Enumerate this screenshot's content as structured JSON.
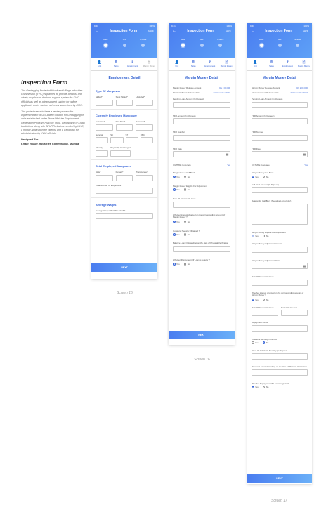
{
  "intro": {
    "title": "Inspection Form",
    "para1": "The Geotagging Project of Khadi and Village Industries Commission (KVIC) is planned to provide a robust and widely map based decision support system for KVIC officials as well as a transparent system for online applicants under various schemes supervised by KVIC.",
    "para2": "The project seeks to have a tender process for implementation of GIS-based solution for Geotagging of units established under Prime Minister Employment Generation Program PMEGP, India, Geotagging of Khadi institutions along with SFURTI clusters needed by KVIC, a mobile application for citizens and a Geoportal for administration by KVIC officials.",
    "designed_for": "Designed For -",
    "client": "Khadi Village Industries Commission, Mumbai"
  },
  "app": {
    "status_time": "9:41",
    "status_right": "100%",
    "back": "←",
    "title": "Inspection Form",
    "save": "SAVE",
    "steps": [
      "Basic",
      "Unit",
      "Scheme"
    ],
    "tabs": [
      {
        "label": "Unit",
        "icon": "👤"
      },
      {
        "label": "Sales",
        "icon": "🖩"
      },
      {
        "label": "Employment",
        "icon": "₹"
      },
      {
        "label": "Margin Money",
        "icon": "🗎"
      }
    ],
    "next": "NEXT"
  },
  "screen15": {
    "section": "Employment Detail",
    "type_of_manpower": "Type Of Manpower",
    "skilled": "Skilled*",
    "semi_skilled": "Semi Skilled*",
    "unskilled": "Unskilled*",
    "current_manpower": "Currently Employed Manpower",
    "full_time": "Full Time*",
    "part_time": "Part Time*",
    "seasonal": "Seasonal*",
    "general": "General",
    "sc": "SC",
    "st": "ST",
    "obc": "OBC",
    "minority": "Minority",
    "physically_challenged": "Physically Challenged",
    "total_manpower": "Total Employed Manpower",
    "male": "Male*",
    "female": "Female*",
    "transgender": "Transgender*",
    "total_employees": "Total Number Of Employees",
    "average_wages": "Average Wages",
    "avg_wages_paid": "Average Wages Paid Per Month*",
    "caption": "Screen 15"
  },
  "screen16": {
    "section": "Margin Money Detail",
    "release_amount_label": "Margin Money Release Amount",
    "release_amount_value": "Rs 2,00,000",
    "first_installment_label": "First Installment Release Date",
    "first_installment_value": "22 December 2016",
    "pending_loan": "Pending Loan Amount (In Rupees)",
    "tdr_amount": "TDR Amount (In Rupees)",
    "tdr_number": "TDR Number",
    "tdr_date": "TDR Date",
    "cgtmse": "CGTMSE Coverage",
    "cgtmse_value": "Yes",
    "call_back": "Margin Money Call Back",
    "eligible_adjustment": "Margin Money Eligible For Adjustment",
    "rate_of_interest": "Rate Of Interest On Loan",
    "interest_charged": "Whether interest charged on the corresponding amount of Margin Money ?",
    "collateral": "Collateral Security Obtained ?",
    "balance_loan": "Balance Loan Outstanding on the date of Physical Verification",
    "repayment": "Whether Repayment Of Loan is regular ?",
    "yes": "Yes",
    "no": "No",
    "caption": "Screen 16"
  },
  "screen17": {
    "section": "Margin Money Detail",
    "call_back_amount": "Call Back Amount (In Rupees)",
    "reason_call_back": "Reason for Call Back (Negative List Activity)",
    "adjustment_amount": "Margin Money Adjustment Amount",
    "adjustment_date": "Margin Money Adjustment Date",
    "rate_of_interest_label": "Rate Of Interest Of Loan",
    "period_of_interest": "Period Of Interest",
    "repayment_period": "Repayment Period",
    "total_collateral": "Value Of Collateral Security (In Rupees)",
    "caption": "Screen 17"
  }
}
